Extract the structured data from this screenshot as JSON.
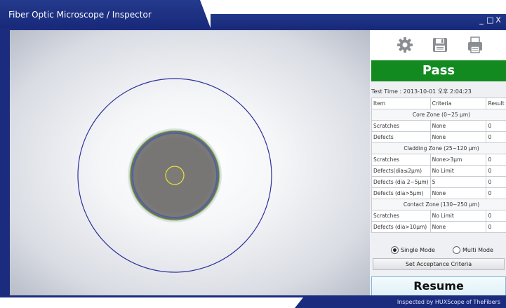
{
  "window": {
    "title": "Fiber Optic Microscope / Inspector",
    "controls": [
      "_",
      "□",
      "X"
    ]
  },
  "toolbar": {
    "icons": [
      "gear-icon",
      "save-icon",
      "print-icon"
    ]
  },
  "result": {
    "status": "Pass",
    "status_color": "#138a1f",
    "test_time_label": "Test Time :",
    "test_time_value": "2013-10-01 오후 2:04:23"
  },
  "table": {
    "headers": [
      "Item",
      "Criteria",
      "Result"
    ],
    "core_zone": "Core Zone (0~25 μm)",
    "core_rows": [
      [
        "Scratches",
        "None",
        "0"
      ],
      [
        "Defects",
        "None",
        "0"
      ]
    ],
    "cladding_zone": "Cladding Zone (25~120 μm)",
    "cladding_rows": [
      [
        "Scratches",
        "None>3μm",
        "0"
      ],
      [
        "Defects(dia≤2μm)",
        "No Limit",
        "0"
      ],
      [
        "Defects (dia 2~5μm)",
        "5",
        "0"
      ],
      [
        "Defects (dia>5μm)",
        "None",
        "0"
      ]
    ],
    "contact_zone": "Contact Zone (130~250 μm)",
    "contact_rows": [
      [
        "Scratches",
        "No Limit",
        "0"
      ],
      [
        "Defects (dia>10μm)",
        "None",
        "0"
      ]
    ]
  },
  "modes": {
    "single": "Single Mode",
    "multi": "Multi Mode",
    "selected": "single"
  },
  "buttons": {
    "set_criteria": "Set Acceptance Criteria",
    "resume": "Resume"
  },
  "footer": {
    "text": "Inspected by HUXScope of TheFibers"
  },
  "colors": {
    "frame": "#1b2b7d",
    "zone_ring": "#2a2f9a",
    "cladding_ring": "#8fd16b",
    "core_ring": "#e8e23a"
  }
}
